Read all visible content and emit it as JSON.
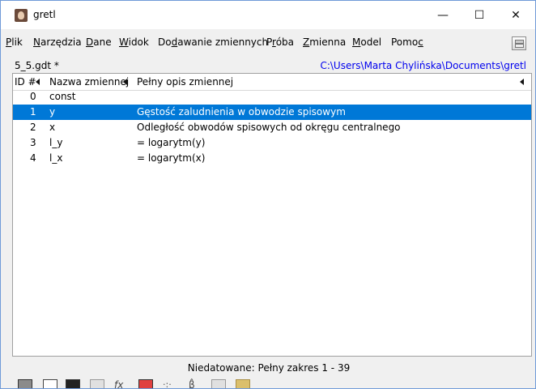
{
  "window": {
    "title": "gretl",
    "controls": {
      "minimize": "—",
      "maximize": "☐",
      "close": "✕"
    }
  },
  "menu": [
    {
      "pre": "",
      "u": "P",
      "post": "lik"
    },
    {
      "pre": "",
      "u": "N",
      "post": "arzędzia"
    },
    {
      "pre": "",
      "u": "D",
      "post": "ane"
    },
    {
      "pre": "",
      "u": "W",
      "post": "idok"
    },
    {
      "pre": "Do",
      "u": "d",
      "post": "awanie zmiennych"
    },
    {
      "pre": "P",
      "u": "r",
      "post": "óba"
    },
    {
      "pre": "",
      "u": "Z",
      "post": "mienna"
    },
    {
      "pre": "",
      "u": "M",
      "post": "odel"
    },
    {
      "pre": "Pomo",
      "u": "c",
      "post": ""
    }
  ],
  "file": {
    "name": "5_5.gdt *",
    "path": "C:\\Users\\Marta Chylińska\\Documents\\gretl"
  },
  "table": {
    "headers": [
      "ID #",
      "Nazwa zmiennej",
      "Pełny opis zmiennej"
    ],
    "rows": [
      {
        "id": "0",
        "name": "const",
        "desc": ""
      },
      {
        "id": "1",
        "name": "y",
        "desc": "Gęstość zaludnienia w obwodzie spisowym",
        "selected": true
      },
      {
        "id": "2",
        "name": "x",
        "desc": "Odległość obwodów spisowych od okręgu centralnego"
      },
      {
        "id": "3",
        "name": "l_y",
        "desc": "= logarytm(y)"
      },
      {
        "id": "4",
        "name": "l_x",
        "desc": "= logarytm(x)"
      }
    ]
  },
  "status": "Niedatowane: Pełny zakres 1 - 39",
  "toolbar": {
    "fx_label": "fx",
    "hat_label": "β̂",
    "dots_label": "·:·"
  },
  "colors": {
    "selection": "#0078d7",
    "path_link": "#0000ee"
  }
}
